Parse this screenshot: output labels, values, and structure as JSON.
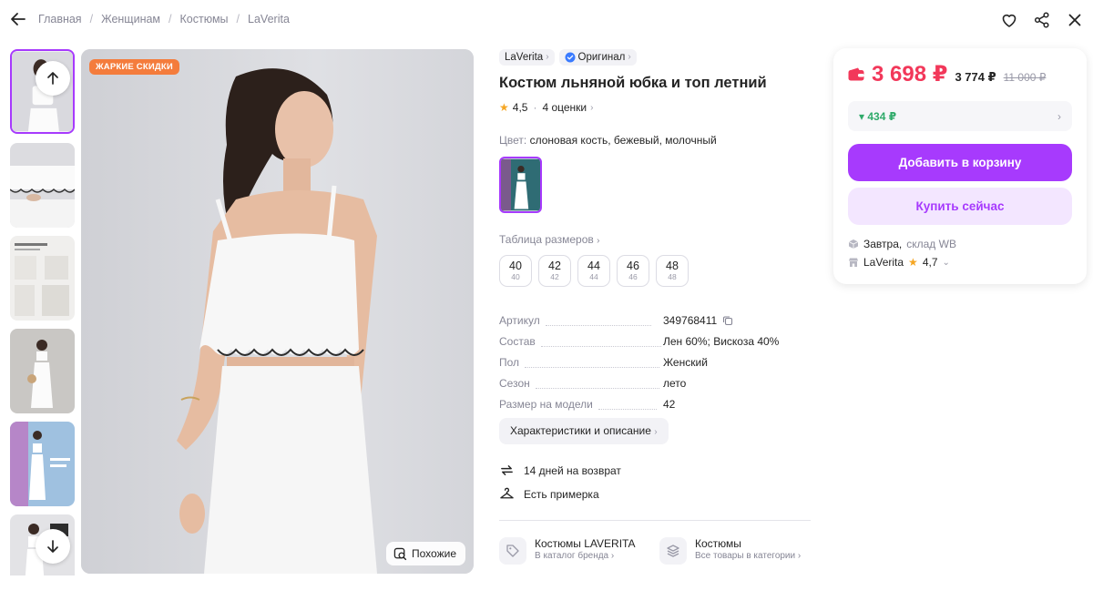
{
  "breadcrumb": {
    "items": [
      "Главная",
      "Женщинам",
      "Костюмы",
      "LaVerita"
    ]
  },
  "gallery": {
    "promo_badge": "ЖАРКИЕ СКИДКИ",
    "similar_label": "Похожие"
  },
  "product": {
    "brand": "LaVerita",
    "original_label": "Оригинал",
    "title": "Костюм льняной юбка и топ летний",
    "rating": "4,5",
    "reviews": "4 оценки",
    "color_label": "Цвет:",
    "color_value": "слоновая кость, бежевый, молочный",
    "size_table_label": "Таблица размеров",
    "sizes": [
      {
        "main": "40",
        "sub": "40"
      },
      {
        "main": "42",
        "sub": "42"
      },
      {
        "main": "44",
        "sub": "44"
      },
      {
        "main": "46",
        "sub": "46"
      },
      {
        "main": "48",
        "sub": "48"
      }
    ],
    "specs": [
      {
        "key": "Артикул",
        "value": "349768411"
      },
      {
        "key": "Состав",
        "value": "Лен 60%; Вискоза 40%"
      },
      {
        "key": "Пол",
        "value": "Женский"
      },
      {
        "key": "Сезон",
        "value": "лето"
      },
      {
        "key": "Размер на модели",
        "value": "42"
      }
    ],
    "description_button": "Характеристики и описание",
    "return_text": "14 дней на возврат",
    "fitting_text": "Есть примерка",
    "brand_catalog": {
      "title": "Костюмы LAVERITA",
      "subtitle": "В каталог бренда"
    },
    "category": {
      "title": "Костюмы",
      "subtitle": "Все товары в категории"
    }
  },
  "price_card": {
    "price": "3 698 ₽",
    "wallet_price": "3 774 ₽",
    "old_price": "11 000 ₽",
    "cashback": "434 ₽",
    "add_to_cart": "Добавить в корзину",
    "buy_now": "Купить сейчас",
    "delivery_day": "Завтра,",
    "delivery_warehouse": "склад WB",
    "seller_name": "LaVerita",
    "seller_rating": "4,7"
  },
  "colors": {
    "accent": "#a73afd",
    "price": "#f2385a",
    "cashback": "#2faa6a",
    "promo": "#f47c3c"
  }
}
